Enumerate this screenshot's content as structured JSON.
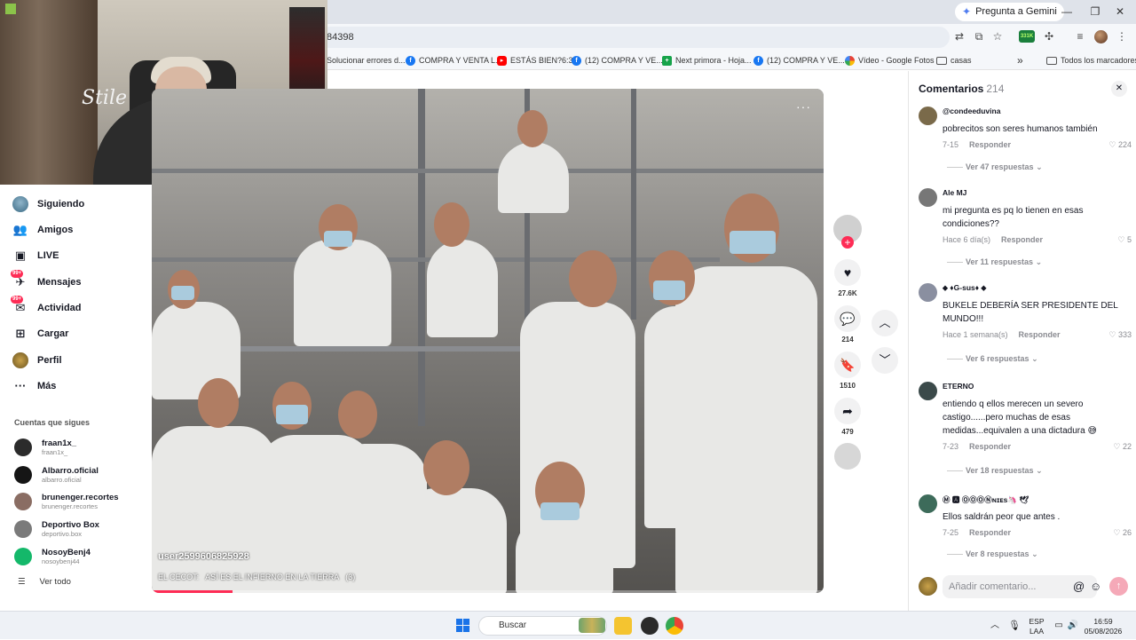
{
  "browser": {
    "gemini_label": "Pregunta a Gemini",
    "url_fragment": "84398",
    "extension_badge": "331K",
    "bookmarks": [
      {
        "label": "Solucionar errores d...",
        "icon": "page-icon"
      },
      {
        "label": "COMPRA Y VENTA L...",
        "icon": "facebook-icon"
      },
      {
        "label": "ESTÁS BIEN?6:33",
        "icon": "youtube-icon"
      },
      {
        "label": "(12) COMPRA Y VE...",
        "icon": "facebook-icon"
      },
      {
        "label": "Next primora - Hoja...",
        "icon": "sheets-icon"
      },
      {
        "label": "(12) COMPRA Y VE...",
        "icon": "facebook-icon"
      },
      {
        "label": "Vídeo - Google Fotos",
        "icon": "photos-icon"
      },
      {
        "label": "casas",
        "icon": "folder-icon"
      }
    ],
    "more_bookmarks": "»",
    "all_bookmarks": "Todos los marcadores"
  },
  "sidebar": {
    "nav": [
      {
        "label": "Siguiendo",
        "icon": "following-avatar-icon"
      },
      {
        "label": "Amigos",
        "icon": "friends-icon"
      },
      {
        "label": "LIVE",
        "icon": "live-icon"
      },
      {
        "label": "Mensajes",
        "icon": "messages-icon",
        "badge": "99+"
      },
      {
        "label": "Actividad",
        "icon": "activity-icon",
        "badge": "99+"
      },
      {
        "label": "Cargar",
        "icon": "upload-icon"
      },
      {
        "label": "Perfil",
        "icon": "profile-avatar-icon"
      },
      {
        "label": "Más",
        "icon": "more-icon"
      }
    ],
    "following_title": "Cuentas que sigues",
    "accounts": [
      {
        "name": "fraan1x_",
        "handle": "fraan1x_",
        "color": "#2b2b2b"
      },
      {
        "name": "Albarro.oficial",
        "handle": "albarro.oficial",
        "color": "#151515"
      },
      {
        "name": "brunenger.recortes",
        "handle": "brunenger.recortes",
        "color": "#8a6d63"
      },
      {
        "name": "Deportivo Box",
        "handle": "deportivo.box",
        "color": "#7a7a7a"
      },
      {
        "name": "NosoyBenj4",
        "handle": "nosoybenj44",
        "color": "#14b86a"
      }
    ],
    "see_all": "Ver todo"
  },
  "video": {
    "username": "user2599606825928",
    "caption": "EL CECOT:   ASÍ ES EL INFIERNO EN LA TIERRA   (3)",
    "progress": 0.12,
    "more": "···",
    "likes": "27.6K",
    "comments": "214",
    "saves": "1510",
    "shares": "479"
  },
  "comments_panel": {
    "title": "Comentarios",
    "count": "214",
    "close": "✕",
    "items": [
      {
        "user": "@condeeduvina",
        "text": "pobrecitos son seres humanos también",
        "date": "7-15",
        "reply": "Responder",
        "likes": "224",
        "replies": "Ver 47 respuestas",
        "avatar_color": "#7a6a4a"
      },
      {
        "user": "Ale MJ",
        "text": "mi pregunta es pq lo tienen en esas condiciones??",
        "date": "Hace 6 día(s)",
        "reply": "Responder",
        "likes": "5",
        "replies": "Ver 11 respuestas",
        "avatar_color": "#777"
      },
      {
        "user": "⬥ ♦G-sus♦ ⬥",
        "text": "BUKELE DEBERÍA SER PRESIDENTE DEL MUNDO!!!",
        "date": "Hace 1 semana(s)",
        "reply": "Responder",
        "likes": "333",
        "replies": "Ver 6 respuestas",
        "avatar_color": "#8a8fa0"
      },
      {
        "user": "ETERNO",
        "text": "entiendo q ellos merecen un severo castigo......pero muchas de esas medidas...equivalen a una dictadura 😅",
        "date": "7-23",
        "reply": "Responder",
        "likes": "22",
        "replies": "Ver 18 respuestas",
        "avatar_color": "#3b4a4a"
      },
      {
        "user": "Ⓜ 🅰 ⓄⓄⓄⓃɴɪᴇs🦄 🕊",
        "text": "Ellos saldrán peor que antes .",
        "date": "7-25",
        "reply": "Responder",
        "likes": "26",
        "replies": "Ver 8 respuestas",
        "avatar_color": "#3d6b5a"
      }
    ],
    "input_placeholder": "Añadir comentario...",
    "mention_icon": "@",
    "emoji_icon": "☺"
  },
  "taskbar": {
    "search_placeholder": "Buscar",
    "lang_top": "ESP",
    "lang_bottom": "LAA",
    "time": "16:59",
    "date": "05/08/2026"
  }
}
